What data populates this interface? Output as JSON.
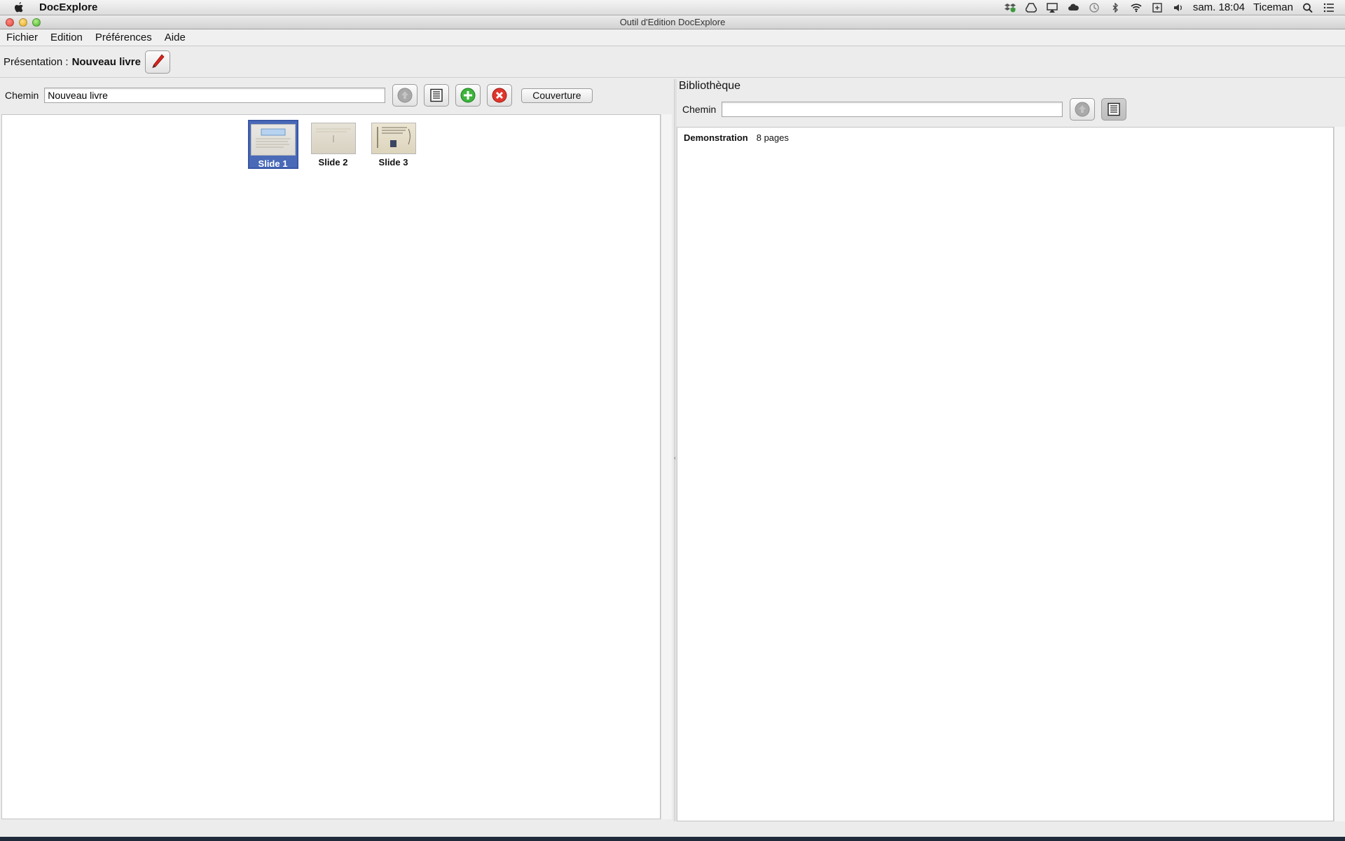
{
  "mac_menubar": {
    "app_name": "DocExplore",
    "clock": "sam. 18:04",
    "user": "Ticeman",
    "status_icons": [
      "dropbox-icon",
      "google-drive-icon",
      "airplay-icon",
      "cloud-icon",
      "time-machine-icon",
      "bluetooth-icon",
      "wifi-icon",
      "keyboard-input-icon",
      "volume-icon"
    ]
  },
  "window": {
    "title": "Outil d'Edition DocExplore"
  },
  "menu": {
    "items": [
      "Fichier",
      "Edition",
      "Préférences",
      "Aide"
    ]
  },
  "presentation": {
    "label": "Présentation :",
    "name": "Nouveau livre"
  },
  "left_toolbar": {
    "path_label": "Chemin",
    "path_value": "Nouveau livre",
    "cover_button": "Couverture"
  },
  "slides": [
    {
      "label": "Slide 1",
      "selected": true
    },
    {
      "label": "Slide 2",
      "selected": false
    },
    {
      "label": "Slide 3",
      "selected": false
    }
  ],
  "library": {
    "title": "Bibliothèque",
    "path_label": "Chemin",
    "path_value": "",
    "books": [
      {
        "name": "Demonstration",
        "pages": "8 pages"
      }
    ]
  },
  "colors": {
    "selection": "#4a6ab8",
    "add": "#3cb43c",
    "delete": "#e0352b"
  }
}
